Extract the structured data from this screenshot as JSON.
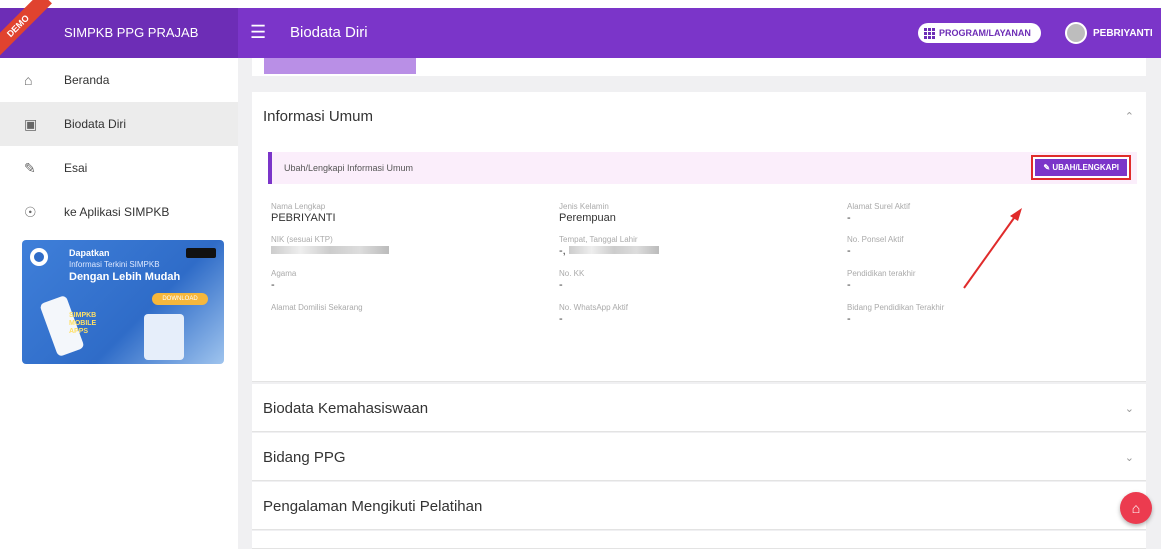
{
  "app": {
    "brand": "SIMPKB PPG PRAJAB",
    "demo_label": "DEMO",
    "page_title": "Biodata Diri",
    "program_button": "PROGRAM/LAYANAN",
    "user_name": "PEBRIYANTI"
  },
  "sidebar": {
    "items": [
      {
        "label": "Beranda",
        "icon": "home-icon"
      },
      {
        "label": "Biodata Diri",
        "icon": "id-card-icon"
      },
      {
        "label": "Esai",
        "icon": "edit-icon"
      },
      {
        "label": "ke Aplikasi SIMPKB",
        "icon": "network-icon"
      }
    ],
    "banner": {
      "line1": "Dapatkan",
      "line2": "Informasi Terkini SIMPKB",
      "line3": "Dengan Lebih Mudah",
      "download": "DOWNLOAD",
      "apps": "SIMPKB MOBILE APPS"
    }
  },
  "info": {
    "title": "Informasi Umum",
    "notice": "Ubah/Lengkapi Informasi Umum",
    "edit_button": "UBAH/LENGKAPI",
    "fields": [
      {
        "label": "Nama Lengkap",
        "value": "PEBRIYANTI"
      },
      {
        "label": "Jenis Kelamin",
        "value": "Perempuan"
      },
      {
        "label": "Alamat Surel Aktif",
        "value": "-"
      },
      {
        "label": "NIK (sesuai KTP)",
        "value": ""
      },
      {
        "label": "Tempat, Tanggal Lahir",
        "value": "-,"
      },
      {
        "label": "No. Ponsel Aktif",
        "value": "-"
      },
      {
        "label": "Agama",
        "value": "-"
      },
      {
        "label": "No. KK",
        "value": "-"
      },
      {
        "label": "Pendidikan terakhir",
        "value": "-"
      },
      {
        "label": "Alamat Domilisi Sekarang",
        "value": ""
      },
      {
        "label": "No. WhatsApp Aktif",
        "value": "-"
      },
      {
        "label": "Bidang Pendidikan Terakhir",
        "value": "-"
      }
    ]
  },
  "sections": [
    {
      "title": "Biodata Kemahasiswaan"
    },
    {
      "title": "Bidang PPG"
    },
    {
      "title": "Pengalaman Mengikuti Pelatihan"
    }
  ],
  "colors": {
    "primary": "#7b35c9",
    "accent": "#ec3b4f",
    "highlight": "#e02b2b"
  }
}
